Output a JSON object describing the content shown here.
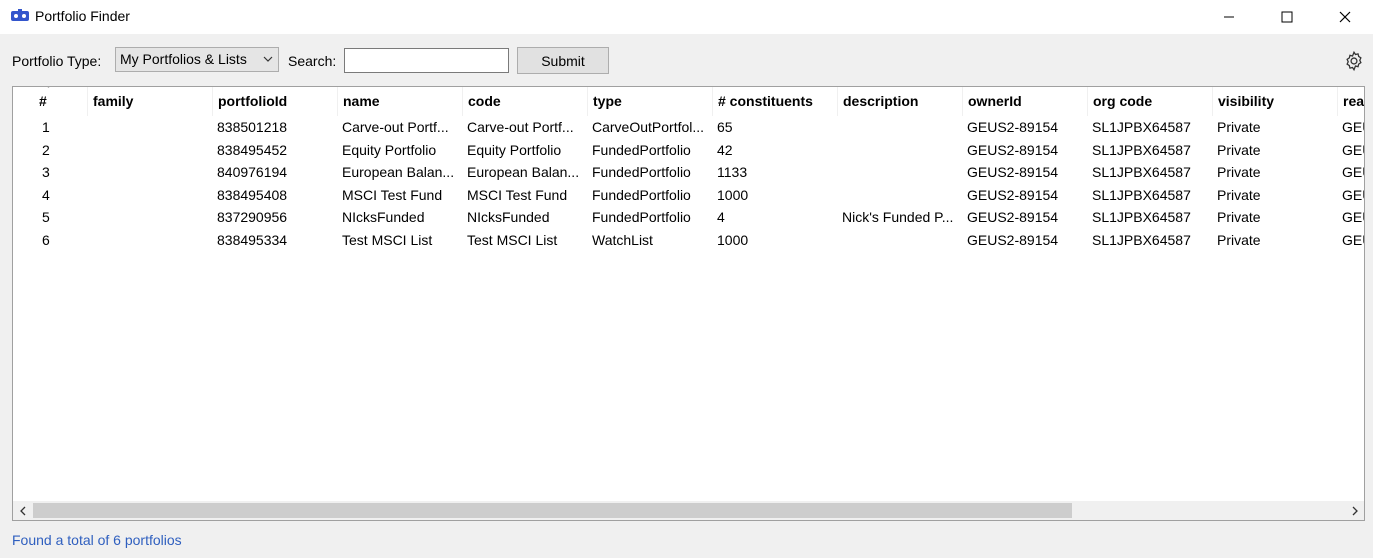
{
  "window": {
    "title": "Portfolio Finder",
    "controls": {
      "minimize": "minimize",
      "maximize": "maximize",
      "close": "close"
    }
  },
  "toolbar": {
    "portfolio_type_label": "Portfolio Type:",
    "portfolio_type_value": "My Portfolios & Lists",
    "search_label": "Search:",
    "search_value": "",
    "submit_label": "Submit",
    "settings_icon": "gear-icon"
  },
  "grid": {
    "columns": [
      "#",
      "family",
      "portfolioId",
      "name",
      "code",
      "type",
      "# constituents",
      "description",
      "ownerId",
      "org code",
      "visibility",
      "rea"
    ],
    "rows": [
      [
        "1",
        "",
        "838501218",
        "Carve-out Portf...",
        "Carve-out Portf...",
        "CarveOutPortfol...",
        "65",
        "",
        "GEUS2-89154",
        "SL1JPBX64587",
        "Private",
        "GEU"
      ],
      [
        "2",
        "",
        "838495452",
        "Equity Portfolio",
        "Equity Portfolio",
        "FundedPortfolio",
        "42",
        "",
        "GEUS2-89154",
        "SL1JPBX64587",
        "Private",
        "GEU"
      ],
      [
        "3",
        "",
        "840976194",
        "European Balan...",
        "European Balan...",
        "FundedPortfolio",
        "1133",
        "",
        "GEUS2-89154",
        "SL1JPBX64587",
        "Private",
        "GEU"
      ],
      [
        "4",
        "",
        "838495408",
        "MSCI Test Fund",
        "MSCI Test Fund",
        "FundedPortfolio",
        "1000",
        "",
        "GEUS2-89154",
        "SL1JPBX64587",
        "Private",
        "GEU"
      ],
      [
        "5",
        "",
        "837290956",
        "NIcksFunded",
        "NIcksFunded",
        "FundedPortfolio",
        "4",
        "Nick's Funded P...",
        "GEUS2-89154",
        "SL1JPBX64587",
        "Private",
        "GEU"
      ],
      [
        "6",
        "",
        "838495334",
        "Test MSCI List",
        "Test MSCI List",
        "WatchList",
        "1000",
        "",
        "GEUS2-89154",
        "SL1JPBX64587",
        "Private",
        "GEU"
      ]
    ]
  },
  "status": {
    "text": "Found a total of 6 portfolios",
    "color": "#2f5fbf"
  }
}
